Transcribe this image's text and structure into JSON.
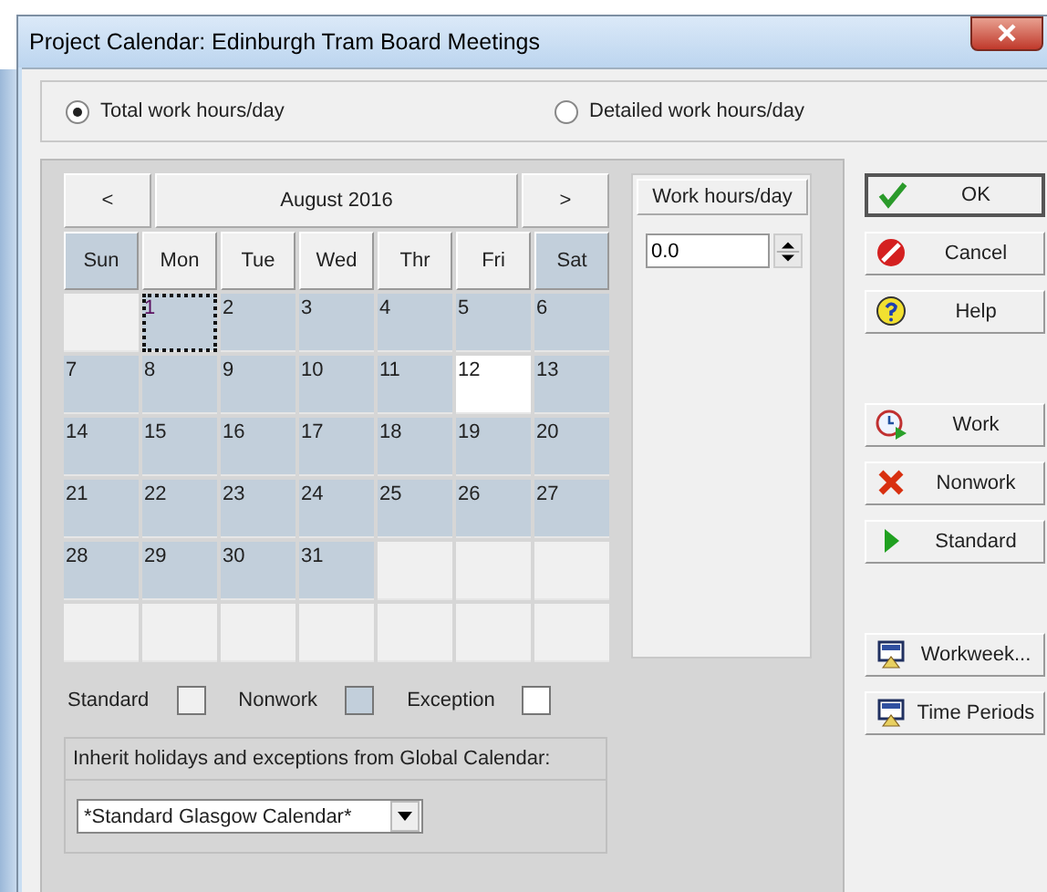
{
  "window": {
    "title": "Project Calendar: Edinburgh Tram Board Meetings"
  },
  "mode_options": [
    {
      "label": "Total work hours/day",
      "selected": true
    },
    {
      "label": "Detailed work hours/day",
      "selected": false
    }
  ],
  "calendar": {
    "prev": "<",
    "month": "August 2016",
    "next": ">",
    "weekdays": [
      {
        "label": "Sun",
        "kind": "nonwork"
      },
      {
        "label": "Mon",
        "kind": "standard"
      },
      {
        "label": "Tue",
        "kind": "standard"
      },
      {
        "label": "Wed",
        "kind": "standard"
      },
      {
        "label": "Thr",
        "kind": "standard"
      },
      {
        "label": "Fri",
        "kind": "standard"
      },
      {
        "label": "Sat",
        "kind": "nonwork"
      }
    ],
    "weeks": [
      [
        {
          "kind": "empty",
          "selected": false
        },
        {
          "day": "1",
          "kind": "nonwork",
          "selected": true
        },
        {
          "day": "2",
          "kind": "nonwork",
          "selected": false
        },
        {
          "day": "3",
          "kind": "nonwork",
          "selected": false
        },
        {
          "day": "4",
          "kind": "nonwork",
          "selected": false
        },
        {
          "day": "5",
          "kind": "nonwork",
          "selected": false
        },
        {
          "day": "6",
          "kind": "nonwork",
          "selected": false
        }
      ],
      [
        {
          "day": "7",
          "kind": "nonwork",
          "selected": false
        },
        {
          "day": "8",
          "kind": "nonwork",
          "selected": false
        },
        {
          "day": "9",
          "kind": "nonwork",
          "selected": false
        },
        {
          "day": "10",
          "kind": "nonwork",
          "selected": false
        },
        {
          "day": "11",
          "kind": "nonwork",
          "selected": false
        },
        {
          "day": "12",
          "kind": "exception",
          "selected": false
        },
        {
          "day": "13",
          "kind": "nonwork",
          "selected": false
        }
      ],
      [
        {
          "day": "14",
          "kind": "nonwork",
          "selected": false
        },
        {
          "day": "15",
          "kind": "nonwork",
          "selected": false
        },
        {
          "day": "16",
          "kind": "nonwork",
          "selected": false
        },
        {
          "day": "17",
          "kind": "nonwork",
          "selected": false
        },
        {
          "day": "18",
          "kind": "nonwork",
          "selected": false
        },
        {
          "day": "19",
          "kind": "nonwork",
          "selected": false
        },
        {
          "day": "20",
          "kind": "nonwork",
          "selected": false
        }
      ],
      [
        {
          "day": "21",
          "kind": "nonwork",
          "selected": false
        },
        {
          "day": "22",
          "kind": "nonwork",
          "selected": false
        },
        {
          "day": "23",
          "kind": "nonwork",
          "selected": false
        },
        {
          "day": "24",
          "kind": "nonwork",
          "selected": false
        },
        {
          "day": "25",
          "kind": "nonwork",
          "selected": false
        },
        {
          "day": "26",
          "kind": "nonwork",
          "selected": false
        },
        {
          "day": "27",
          "kind": "nonwork",
          "selected": false
        }
      ],
      [
        {
          "day": "28",
          "kind": "nonwork",
          "selected": false
        },
        {
          "day": "29",
          "kind": "nonwork",
          "selected": false
        },
        {
          "day": "30",
          "kind": "nonwork",
          "selected": false
        },
        {
          "day": "31",
          "kind": "nonwork",
          "selected": false
        },
        {
          "kind": "empty",
          "selected": false
        },
        {
          "kind": "empty",
          "selected": false
        },
        {
          "kind": "empty",
          "selected": false
        }
      ],
      [
        {
          "kind": "empty",
          "selected": false
        },
        {
          "kind": "empty",
          "selected": false
        },
        {
          "kind": "empty",
          "selected": false
        },
        {
          "kind": "empty",
          "selected": false
        },
        {
          "kind": "empty",
          "selected": false
        },
        {
          "kind": "empty",
          "selected": false
        },
        {
          "kind": "empty",
          "selected": false
        }
      ]
    ]
  },
  "work_hours": {
    "title": "Work hours/day",
    "value": "0.0"
  },
  "legend": [
    {
      "label": "Standard",
      "kind": "standard"
    },
    {
      "label": "Nonwork",
      "kind": "nonwork"
    },
    {
      "label": "Exception",
      "kind": "exception"
    }
  ],
  "inherit": {
    "label": "Inherit holidays and exceptions from Global Calendar:",
    "value": "*Standard Glasgow Calendar*"
  },
  "buttons": [
    {
      "label": "OK",
      "kind": "check",
      "default": true
    },
    {
      "label": "Cancel",
      "kind": "cancel",
      "default": false
    },
    {
      "label": "Help",
      "kind": "help",
      "default": false
    },
    {
      "label": "Work",
      "kind": "clock",
      "default": false
    },
    {
      "label": "Nonwork",
      "kind": "cross",
      "default": false
    },
    {
      "label": "Standard",
      "kind": "play",
      "default": false
    },
    {
      "label": "Workweek...",
      "kind": "monitor",
      "default": false
    },
    {
      "label": "Time Periods",
      "kind": "monitor",
      "default": false
    }
  ]
}
